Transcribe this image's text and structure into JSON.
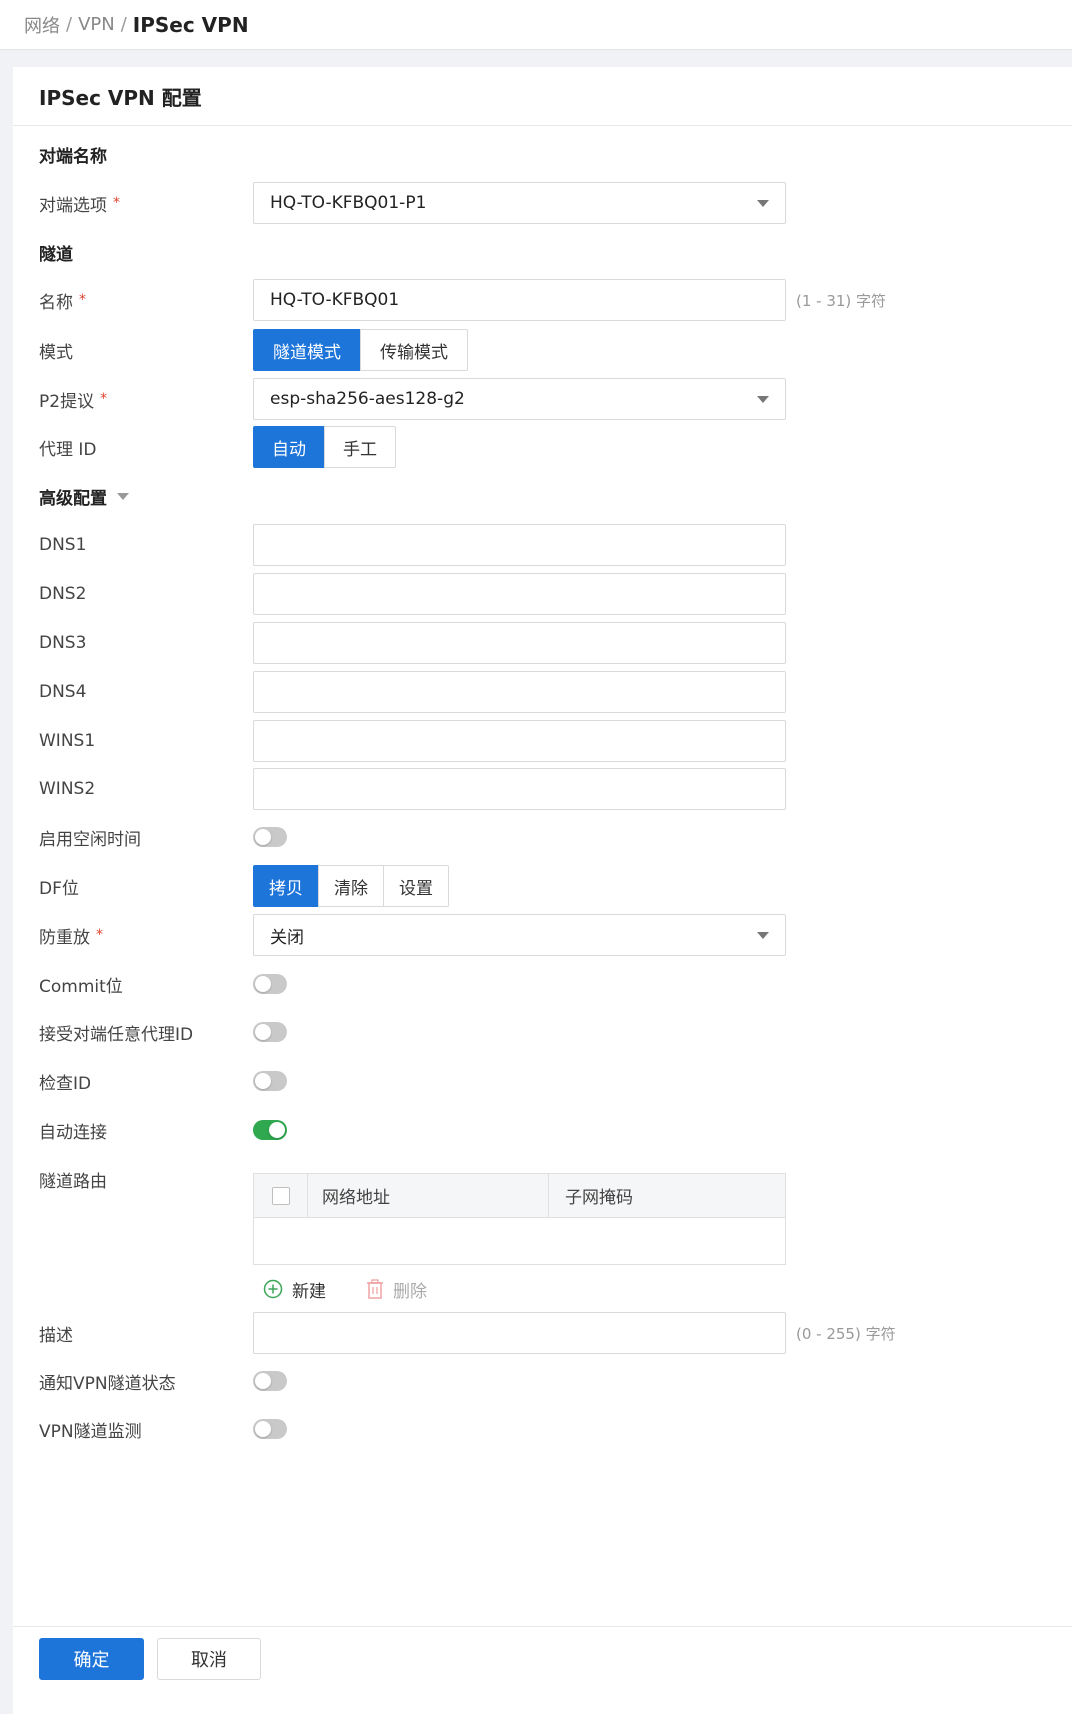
{
  "breadcrumb": {
    "items": [
      "网络",
      "VPN"
    ],
    "current": "IPSec VPN",
    "separator": "/"
  },
  "card": {
    "title": "IPSec VPN 配置"
  },
  "peer_section": {
    "title": "对端名称"
  },
  "peer_option": {
    "label": "对端选项",
    "value": "HQ-TO-KFBQ01-P1"
  },
  "tunnel_section": {
    "title": "隧道"
  },
  "name": {
    "label": "名称",
    "value": "HQ-TO-KFBQ01",
    "hint": "(1 - 31) 字符"
  },
  "mode": {
    "label": "模式",
    "options": [
      "隧道模式",
      "传输模式"
    ],
    "selected": "隧道模式"
  },
  "p2": {
    "label": "P2提议",
    "value": "esp-sha256-aes128-g2"
  },
  "proxy_id": {
    "label": "代理 ID",
    "options": [
      "自动",
      "手工"
    ],
    "selected": "自动"
  },
  "advanced": {
    "title": "高级配置"
  },
  "dns1": {
    "label": "DNS1",
    "value": ""
  },
  "dns2": {
    "label": "DNS2",
    "value": ""
  },
  "dns3": {
    "label": "DNS3",
    "value": ""
  },
  "dns4": {
    "label": "DNS4",
    "value": ""
  },
  "wins1": {
    "label": "WINS1",
    "value": ""
  },
  "wins2": {
    "label": "WINS2",
    "value": ""
  },
  "idle_time": {
    "label": "启用空闲时间",
    "on": false
  },
  "df_bit": {
    "label": "DF位",
    "options": [
      "拷贝",
      "清除",
      "设置"
    ],
    "selected": "拷贝"
  },
  "anti_replay": {
    "label": "防重放",
    "value": "关闭"
  },
  "commit_bit": {
    "label": "Commit位",
    "on": false
  },
  "accept_any_proxy": {
    "label": "接受对端任意代理ID",
    "on": false
  },
  "check_id": {
    "label": "检查ID",
    "on": false
  },
  "auto_connect": {
    "label": "自动连接",
    "on": true
  },
  "tunnel_route": {
    "label": "隧道路由",
    "columns": [
      "网络地址",
      "子网掩码"
    ],
    "rows": [],
    "add_label": "新建",
    "delete_label": "删除"
  },
  "description": {
    "label": "描述",
    "value": "",
    "hint": "(0 - 255) 字符"
  },
  "notify_status": {
    "label": "通知VPN隧道状态",
    "on": false
  },
  "tunnel_monitor": {
    "label": "VPN隧道监测",
    "on": false
  },
  "buttons": {
    "ok": "确定",
    "cancel": "取消"
  },
  "colors": {
    "primary": "#1d74d9",
    "toggle_on": "#2fa84f",
    "required": "#e0402e"
  }
}
